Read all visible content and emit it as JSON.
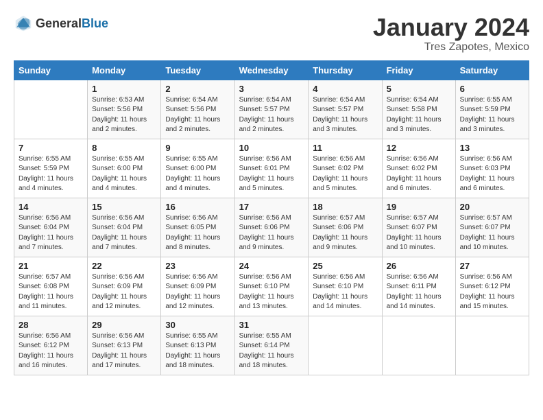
{
  "header": {
    "logo_general": "General",
    "logo_blue": "Blue",
    "title": "January 2024",
    "subtitle": "Tres Zapotes, Mexico"
  },
  "weekdays": [
    "Sunday",
    "Monday",
    "Tuesday",
    "Wednesday",
    "Thursday",
    "Friday",
    "Saturday"
  ],
  "weeks": [
    [
      {
        "num": "",
        "detail": ""
      },
      {
        "num": "1",
        "detail": "Sunrise: 6:53 AM\nSunset: 5:56 PM\nDaylight: 11 hours\nand 2 minutes."
      },
      {
        "num": "2",
        "detail": "Sunrise: 6:54 AM\nSunset: 5:56 PM\nDaylight: 11 hours\nand 2 minutes."
      },
      {
        "num": "3",
        "detail": "Sunrise: 6:54 AM\nSunset: 5:57 PM\nDaylight: 11 hours\nand 2 minutes."
      },
      {
        "num": "4",
        "detail": "Sunrise: 6:54 AM\nSunset: 5:57 PM\nDaylight: 11 hours\nand 3 minutes."
      },
      {
        "num": "5",
        "detail": "Sunrise: 6:54 AM\nSunset: 5:58 PM\nDaylight: 11 hours\nand 3 minutes."
      },
      {
        "num": "6",
        "detail": "Sunrise: 6:55 AM\nSunset: 5:59 PM\nDaylight: 11 hours\nand 3 minutes."
      }
    ],
    [
      {
        "num": "7",
        "detail": "Sunrise: 6:55 AM\nSunset: 5:59 PM\nDaylight: 11 hours\nand 4 minutes."
      },
      {
        "num": "8",
        "detail": "Sunrise: 6:55 AM\nSunset: 6:00 PM\nDaylight: 11 hours\nand 4 minutes."
      },
      {
        "num": "9",
        "detail": "Sunrise: 6:55 AM\nSunset: 6:00 PM\nDaylight: 11 hours\nand 4 minutes."
      },
      {
        "num": "10",
        "detail": "Sunrise: 6:56 AM\nSunset: 6:01 PM\nDaylight: 11 hours\nand 5 minutes."
      },
      {
        "num": "11",
        "detail": "Sunrise: 6:56 AM\nSunset: 6:02 PM\nDaylight: 11 hours\nand 5 minutes."
      },
      {
        "num": "12",
        "detail": "Sunrise: 6:56 AM\nSunset: 6:02 PM\nDaylight: 11 hours\nand 6 minutes."
      },
      {
        "num": "13",
        "detail": "Sunrise: 6:56 AM\nSunset: 6:03 PM\nDaylight: 11 hours\nand 6 minutes."
      }
    ],
    [
      {
        "num": "14",
        "detail": "Sunrise: 6:56 AM\nSunset: 6:04 PM\nDaylight: 11 hours\nand 7 minutes."
      },
      {
        "num": "15",
        "detail": "Sunrise: 6:56 AM\nSunset: 6:04 PM\nDaylight: 11 hours\nand 7 minutes."
      },
      {
        "num": "16",
        "detail": "Sunrise: 6:56 AM\nSunset: 6:05 PM\nDaylight: 11 hours\nand 8 minutes."
      },
      {
        "num": "17",
        "detail": "Sunrise: 6:56 AM\nSunset: 6:06 PM\nDaylight: 11 hours\nand 9 minutes."
      },
      {
        "num": "18",
        "detail": "Sunrise: 6:57 AM\nSunset: 6:06 PM\nDaylight: 11 hours\nand 9 minutes."
      },
      {
        "num": "19",
        "detail": "Sunrise: 6:57 AM\nSunset: 6:07 PM\nDaylight: 11 hours\nand 10 minutes."
      },
      {
        "num": "20",
        "detail": "Sunrise: 6:57 AM\nSunset: 6:07 PM\nDaylight: 11 hours\nand 10 minutes."
      }
    ],
    [
      {
        "num": "21",
        "detail": "Sunrise: 6:57 AM\nSunset: 6:08 PM\nDaylight: 11 hours\nand 11 minutes."
      },
      {
        "num": "22",
        "detail": "Sunrise: 6:56 AM\nSunset: 6:09 PM\nDaylight: 11 hours\nand 12 minutes."
      },
      {
        "num": "23",
        "detail": "Sunrise: 6:56 AM\nSunset: 6:09 PM\nDaylight: 11 hours\nand 12 minutes."
      },
      {
        "num": "24",
        "detail": "Sunrise: 6:56 AM\nSunset: 6:10 PM\nDaylight: 11 hours\nand 13 minutes."
      },
      {
        "num": "25",
        "detail": "Sunrise: 6:56 AM\nSunset: 6:10 PM\nDaylight: 11 hours\nand 14 minutes."
      },
      {
        "num": "26",
        "detail": "Sunrise: 6:56 AM\nSunset: 6:11 PM\nDaylight: 11 hours\nand 14 minutes."
      },
      {
        "num": "27",
        "detail": "Sunrise: 6:56 AM\nSunset: 6:12 PM\nDaylight: 11 hours\nand 15 minutes."
      }
    ],
    [
      {
        "num": "28",
        "detail": "Sunrise: 6:56 AM\nSunset: 6:12 PM\nDaylight: 11 hours\nand 16 minutes."
      },
      {
        "num": "29",
        "detail": "Sunrise: 6:56 AM\nSunset: 6:13 PM\nDaylight: 11 hours\nand 17 minutes."
      },
      {
        "num": "30",
        "detail": "Sunrise: 6:55 AM\nSunset: 6:13 PM\nDaylight: 11 hours\nand 18 minutes."
      },
      {
        "num": "31",
        "detail": "Sunrise: 6:55 AM\nSunset: 6:14 PM\nDaylight: 11 hours\nand 18 minutes."
      },
      {
        "num": "",
        "detail": ""
      },
      {
        "num": "",
        "detail": ""
      },
      {
        "num": "",
        "detail": ""
      }
    ]
  ]
}
